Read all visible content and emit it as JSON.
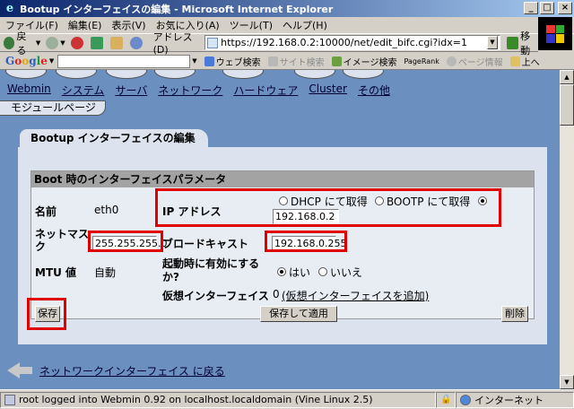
{
  "window": {
    "title": "Bootup インターフェイスの編集 - Microsoft Internet Explorer",
    "buttons": [
      "_",
      "□",
      "×"
    ]
  },
  "menu": [
    "ファイル(F)",
    "編集(E)",
    "表示(V)",
    "お気に入り(A)",
    "ツール(T)",
    "ヘルプ(H)"
  ],
  "toolbar": {
    "back": "戻る",
    "address_label": "アドレス(D)",
    "url": "https://192.168.0.2:10000/net/edit_bifc.cgi?idx=1",
    "go": "移動"
  },
  "google_bar": {
    "web_search": "ウェブ検索",
    "site_search": "サイト検索",
    "image_search": "イメージ検索",
    "pagerank": "PageRank",
    "page_info": "ページ情報",
    "up": "上へ"
  },
  "webmin_nav": [
    "Webmin",
    "システム",
    "サーバ",
    "ネットワーク",
    "ハードウェア",
    "Cluster",
    "その他"
  ],
  "module_page": "モジュールページ",
  "section_title": "Bootup インターフェイスの編集",
  "form": {
    "header": "Boot 時のインターフェイスパラメータ",
    "name_label": "名前",
    "name_value": "eth0",
    "ip_label": "IP アドレス",
    "ip_opt_dhcp": "DHCP にて取得",
    "ip_opt_bootp": "BOOTP にて取得",
    "ip_value": "192.168.0.2",
    "netmask_label": "ネットマスク",
    "netmask_value": "255.255.255.0",
    "broadcast_label": "ブロードキャスト",
    "broadcast_value": "192.168.0.255",
    "mtu_label": "MTU 値",
    "mtu_value": "自動",
    "onboot_label": "起動時に有効にするか?",
    "onboot_yes": "はい",
    "onboot_no": "いいえ",
    "virtual_label": "仮想インターフェイス",
    "virtual_count": "0",
    "virtual_add": "(仮想インターフェイスを追加)"
  },
  "buttons": {
    "save": "保存",
    "save_apply": "保存して適用",
    "delete": "削除"
  },
  "back_link": "ネットワークインターフェイス に戻る",
  "status": {
    "left": "root logged into Webmin 0.92 on localhost.localdomain (Vine Linux 2.5)",
    "zone": "インターネット"
  }
}
